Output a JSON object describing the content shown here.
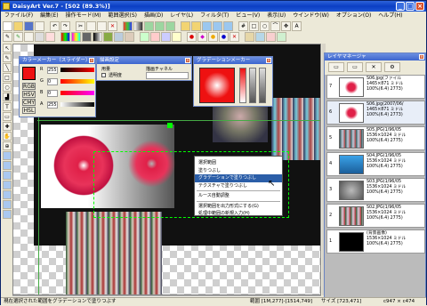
{
  "window": {
    "title": "DaisyArt Ver.7 - [S02 (89.3%)]"
  },
  "menu": [
    "ファイル(F)",
    "編集(E)",
    "操作モード(M)",
    "範囲選択(S)",
    "描画(D)",
    "レイヤ(L)",
    "フィルタ(T)",
    "ビュー(V)",
    "表示(U)",
    "ウインドウ(W)",
    "オプション(O)",
    "ヘルプ(H)"
  ],
  "color_maker": {
    "title": "カラーメーカー（スライダー）",
    "modes": [
      "RGB",
      "HSV",
      "CMY",
      "HSL"
    ],
    "channels": [
      {
        "label": "R",
        "value": "255"
      },
      {
        "label": "G",
        "value": "0"
      },
      {
        "label": "B",
        "value": "0"
      },
      {
        "label": "A",
        "value": "255"
      }
    ],
    "colors": {
      "main": "#ee1111"
    }
  },
  "draw_settings": {
    "title": "描画設定",
    "group1": "用量",
    "check_label": "透明度",
    "group2": "描画チャネル"
  },
  "gradation_maker": {
    "title": "グラデーションメーカー",
    "colors": {
      "c1": "#ee1111",
      "c2": "#ffffff"
    }
  },
  "layer_manager": {
    "title": "レイヤマネージャ",
    "layers": [
      {
        "num": "7",
        "info": "S06.jpg(ファイル\n1465×871 ミドル\n100%(6.4) 2773)"
      },
      {
        "num": "6",
        "info": "S06.jpg(2007/06/\n1465×871 ミドル\n100%(6.4) 2773)"
      },
      {
        "num": "5",
        "info": "S05.JPG(1/96/05\n1536×1024 ミドル\n100%(6.4) 2775)"
      },
      {
        "num": "4",
        "info": "S04.JPG(1/96/05\n1536×1024 ミドル\n100%(6.4) 2775)"
      },
      {
        "num": "3",
        "info": "S03.JPG(1/96/05\n1536×1024 ミドル\n100%(6.4) 2775)"
      },
      {
        "num": "2",
        "info": "S02.JPG(1/96/05\n1536×1024 ミドル\n100%(6.4) 2775)"
      },
      {
        "num": "1",
        "info": "(背景画像)\n1536×1024 ミドル\n100%(6.4) 2775)"
      }
    ]
  },
  "context_menu": {
    "items": [
      "選択範囲",
      "塗りつぶし",
      "グラデーションで塗りつぶし",
      "テクスチャで塗りつぶし",
      "ルース自動調整",
      "選択範囲を出力形式にする(G)",
      "処理中範囲の新規入力(H)"
    ],
    "highlighted": 2
  },
  "status": {
    "left": "現在選択された範囲をグラデーションで塗りつぶす",
    "mid": "範囲 [1M,277]-[1514,749]",
    "size": "サイズ [723,471]",
    "right": "c947 × c474"
  }
}
